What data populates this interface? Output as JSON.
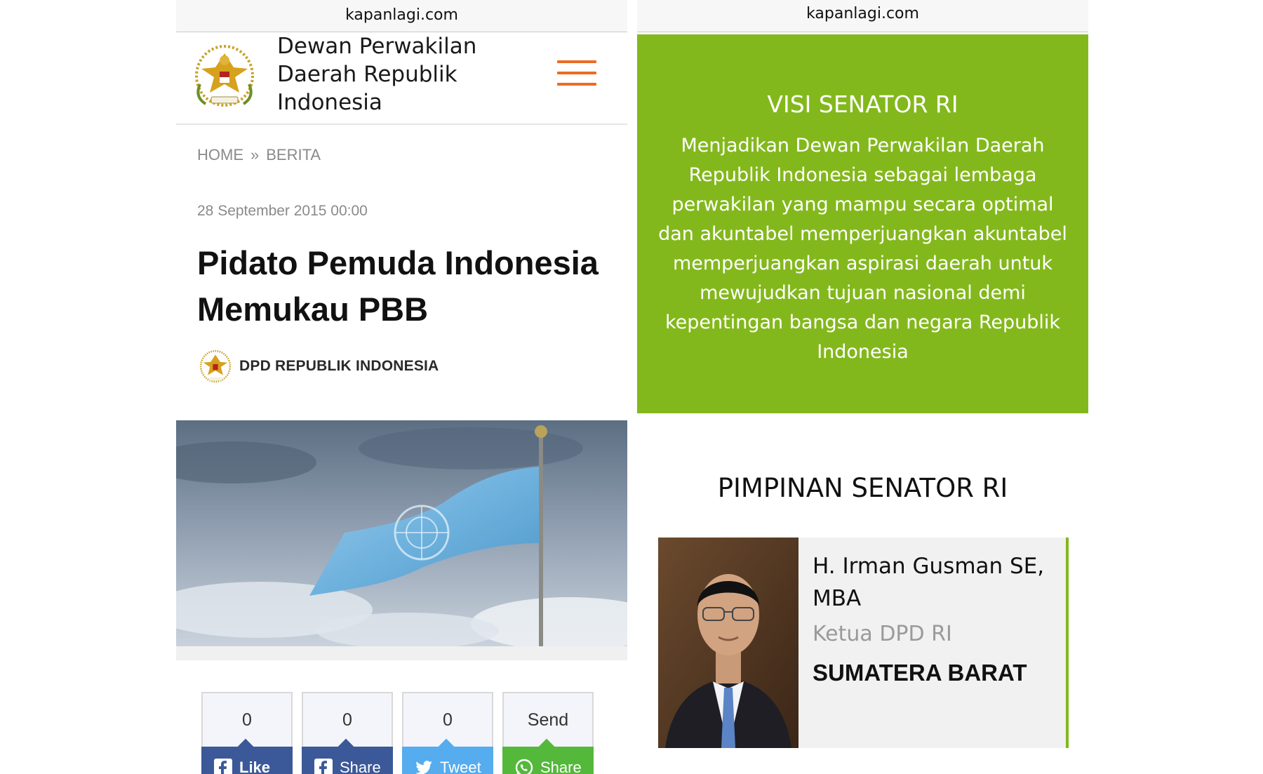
{
  "left": {
    "url": "kapanlagi.com",
    "site_name": "Dewan Perwakilan Daerah Republik Indonesia",
    "menu_icon": "hamburger-menu-icon",
    "breadcrumb": {
      "home": "HOME",
      "sep": "»",
      "current": "BERITA"
    },
    "date": "28 September 2015 00:00",
    "headline": "Pidato Pemuda Indonesia Memukau PBB",
    "source": "DPD REPUBLIK INDONESIA",
    "share": {
      "facebook_like": {
        "count": "0",
        "label": "Like"
      },
      "facebook_share": {
        "count": "0",
        "label": "Share"
      },
      "twitter": {
        "count": "0",
        "label": "Tweet"
      },
      "whatsapp": {
        "count": "Send",
        "label": "Share"
      }
    }
  },
  "right": {
    "url": "kapanlagi.com",
    "visi_title": "VISI SENATOR RI",
    "visi_text": "Menjadikan Dewan Perwakilan Daerah Republik Indonesia sebagai lembaga perwakilan yang mampu secara optimal dan akuntabel memperjuangkan akuntabel memperjuangkan aspirasi daerah untuk mewujudkan tujuan nasional demi kepentingan bangsa dan negara Republik Indonesia",
    "pimpinan_title": "PIMPINAN SENATOR RI",
    "leader": {
      "name": "H. Irman Gusman SE, MBA",
      "role": "Ketua DPD RI",
      "region": "SUMATERA BARAT"
    }
  },
  "colors": {
    "accent_orange": "#ec6b23",
    "green": "#83b81c",
    "facebook": "#3b5998",
    "twitter": "#55acee",
    "whatsapp": "#54b83b"
  }
}
